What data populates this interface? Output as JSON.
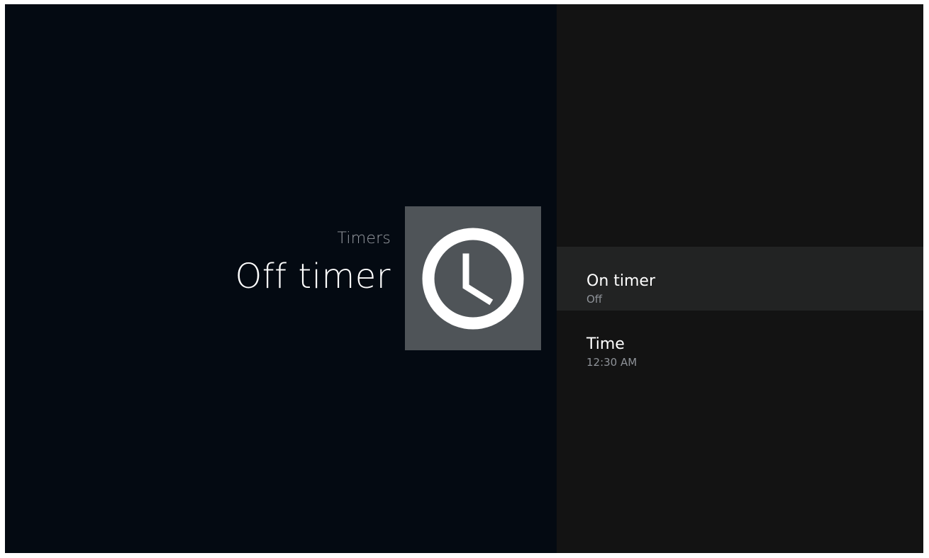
{
  "header": {
    "breadcrumb": "Timers",
    "title": "Off timer"
  },
  "icon": {
    "name": "clock-icon",
    "tile_color": "#4f5458"
  },
  "menu": {
    "items": [
      {
        "title": "On timer",
        "value": "Off",
        "selected": true
      },
      {
        "title": "Time",
        "value": "12:30 AM",
        "selected": false
      }
    ]
  },
  "colors": {
    "left_background": "#040a12",
    "right_background": "#131313",
    "selected_row": "#222323",
    "primary_text": "#ffffff",
    "secondary_text": "#8e9298"
  }
}
